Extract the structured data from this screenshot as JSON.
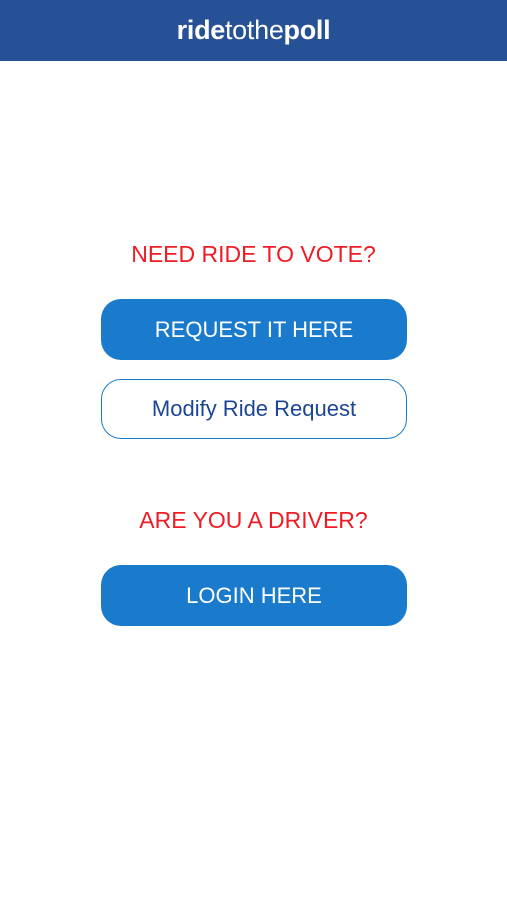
{
  "header": {
    "logo_part1": "ride",
    "logo_part2": "tothe",
    "logo_part3": "poll"
  },
  "rider": {
    "prompt": "NEED RIDE TO VOTE?",
    "request_label": "REQUEST IT HERE",
    "modify_label": "Modify Ride Request"
  },
  "driver": {
    "prompt": "ARE YOU A DRIVER?",
    "login_label": "LOGIN HERE"
  },
  "colors": {
    "header_bg": "#265197",
    "accent_red": "#ee1c25",
    "button_blue": "#1a7acb",
    "outline_text": "#1c4595"
  }
}
